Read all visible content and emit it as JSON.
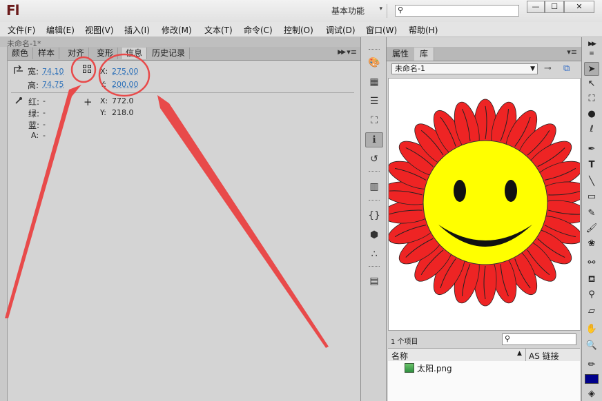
{
  "app": {
    "logo": "Fl",
    "workspace_label": "基本功能",
    "search_placeholder": "",
    "window_min": "—",
    "window_max": "☐",
    "window_close": "✕"
  },
  "menu": [
    "文件(F)",
    "编辑(E)",
    "视图(V)",
    "插入(I)",
    "修改(M)",
    "文本(T)",
    "命令(C)",
    "控制(O)",
    "调试(D)",
    "窗口(W)",
    "帮助(H)"
  ],
  "doc_tab": "未命名-1*",
  "left_panel": {
    "tabs": [
      "颜色",
      "样本",
      "对齐",
      "变形",
      "信息",
      "历史记录"
    ],
    "active_tab": "信息",
    "width_label": "宽:",
    "width_value": "74.10",
    "height_label": "高:",
    "height_value": "74.75",
    "x_label": "X:",
    "x_value": "275.00",
    "y_label": "Y:",
    "y_value": "200.00",
    "red_label": "红:",
    "red_value": "-",
    "green_label": "绿:",
    "green_value": "-",
    "blue_label": "蓝:",
    "blue_value": "-",
    "alpha_label": "A:",
    "alpha_value": "-",
    "cursor_x_label": "X:",
    "cursor_x_value": "772.0",
    "cursor_y_label": "Y:",
    "cursor_y_value": "218.0"
  },
  "library": {
    "tabs": [
      "属性",
      "库"
    ],
    "active_tab": "库",
    "document": "未命名-1",
    "item_count": "1 个项目",
    "col_name": "名称",
    "col_linkage": "AS 链接",
    "items": [
      {
        "name": "太阳.png"
      }
    ]
  },
  "colors": {
    "annotation": "#e84a4a",
    "petal": "#ee2424",
    "face": "#ffff00",
    "stroke_swatch": "#00008b"
  },
  "icons": {
    "left_strip": [
      "color-palette-icon",
      "grid-swatch-icon",
      "align-icon",
      "transform-icon",
      "info-icon",
      "history-icon",
      "library-icon",
      "code-snippet-icon",
      "components-icon",
      "motion-presets-icon",
      "project-icon"
    ],
    "right_tools": [
      "selection-tool-icon",
      "subselection-tool-icon",
      "free-transform-icon",
      "3d-rotation-icon",
      "lasso-icon",
      "pen-icon",
      "text-icon",
      "line-icon",
      "rectangle-icon",
      "pencil-icon",
      "brush-icon",
      "deco-icon",
      "bone-icon",
      "paint-bucket-icon",
      "eyedropper-icon",
      "eraser-icon",
      "hand-icon",
      "zoom-icon",
      "stroke-color-icon"
    ]
  }
}
